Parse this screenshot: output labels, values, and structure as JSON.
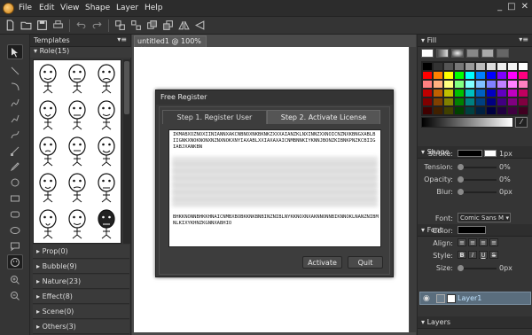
{
  "menu": [
    "File",
    "Edit",
    "View",
    "Shape",
    "Layer",
    "Help"
  ],
  "window_controls": [
    "_",
    "□",
    "✕"
  ],
  "templates": {
    "title": "Templates",
    "role_label": "Role(15)",
    "categories": [
      "Prop(0)",
      "Bubble(9)",
      "Nature(23)",
      "Effect(8)",
      "Scene(0)",
      "Others(3)"
    ]
  },
  "document": {
    "tab_label": "untitled1 @ 100%",
    "tab_close": "✕"
  },
  "dialog": {
    "title": "Free Register",
    "tab1": "Step 1. Register User",
    "tab2": "Step 2. Activate License",
    "code_top": "IKMABXOZNOXIINIANNXAKCNBNOXNKBKNKZXXXAIANZKLNXINNZXXNOICNZNXKBNGXABLBIIGNKXNOKNONXNZNXNOKXNYIAXABLXXIAXAXAICNMBNNKIYKNNJBONZKIBNKPNZKCBIIGIABJXANKBN",
    "code_bottom": "BHKKNONNBHKKHNAICNMBXBOBKKNKBNBINZNIBLNYKKNOXNXAKNNONNBIKNNOKLNANZNIBMNLKIXYKHNZKGNNXABHIO",
    "activate": "Activate",
    "quit": "Quit"
  },
  "fill": {
    "title": "Fill",
    "eyedropper": "⁄"
  },
  "shape": {
    "title": "Shape",
    "stroke_label": "Stroke:",
    "stroke_value": "1px",
    "tension_label": "Tension:",
    "tension_value": "0%",
    "opacity_label": "Opacity:",
    "opacity_value": "0%",
    "blur_label": "Blur:",
    "blur_value": "0px"
  },
  "font": {
    "title": "Font",
    "font_label": "Font:",
    "font_value": "Comic Sans M",
    "color_label": "Color:",
    "align_label": "Align:",
    "style_label": "Style:",
    "style_bold": "B",
    "style_italic": "I",
    "style_underline": "U",
    "style_strike": "S",
    "size_label": "Size:",
    "size_value": "0px"
  },
  "layers": {
    "title": "Layers",
    "layer_name": "Layer1"
  },
  "palette_colors": [
    "#000000",
    "#333333",
    "#555555",
    "#777777",
    "#999999",
    "#bbbbbb",
    "#dddddd",
    "#eeeeee",
    "#f4f4f4",
    "#ffffff",
    "#ff0000",
    "#ff8000",
    "#ffff00",
    "#00ff00",
    "#00ffff",
    "#0080ff",
    "#0000ff",
    "#8000ff",
    "#ff00ff",
    "#ff0080",
    "#ff8080",
    "#ffb080",
    "#ffff80",
    "#80ff80",
    "#80ffff",
    "#80c0ff",
    "#8080ff",
    "#c080ff",
    "#ff80ff",
    "#ff80c0",
    "#c00000",
    "#c06000",
    "#c0c000",
    "#00c000",
    "#00c0c0",
    "#0060c0",
    "#0000c0",
    "#6000c0",
    "#c000c0",
    "#c00060",
    "#800000",
    "#804000",
    "#808000",
    "#008000",
    "#008080",
    "#004080",
    "#000080",
    "#400080",
    "#800080",
    "#800040",
    "#400000",
    "#402000",
    "#404000",
    "#004000",
    "#004040",
    "#002040",
    "#000040",
    "#200040",
    "#400040",
    "#400020"
  ]
}
